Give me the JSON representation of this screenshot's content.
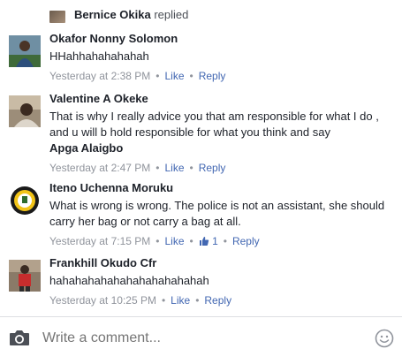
{
  "top": {
    "name": "Bernice Okika",
    "action": "replied"
  },
  "comments": [
    {
      "author": "Okafor Nonny Solomon",
      "text": "HHahhahahahahah",
      "time": "Yesterday at 2:38 PM",
      "like": "Like",
      "reply": "Reply"
    },
    {
      "author": "Valentine A Okeke",
      "text": "That is why I really advice you that am responsible for what I do , and u will b hold responsible for what you think and say",
      "mention": "Apga Alaigbo",
      "time": "Yesterday at 2:47 PM",
      "like": "Like",
      "reply": "Reply"
    },
    {
      "author": "Iteno Uchenna Moruku",
      "text": "What is wrong is wrong. The police is not an assistant, she should carry her bag or not carry a bag at all.",
      "time": "Yesterday at 7:15 PM",
      "like": "Like",
      "like_count": "1",
      "reply": "Reply"
    },
    {
      "author": "Frankhill Okudo Cfr",
      "text": "hahahahahahahahahahahahah",
      "time": "Yesterday at 10:25 PM",
      "like": "Like",
      "reply": "Reply"
    }
  ],
  "composer": {
    "placeholder": "Write a comment..."
  },
  "icons": {
    "camera": "camera-icon",
    "emoji": "smiley-icon",
    "like": "thumbs-up-icon"
  },
  "colors": {
    "link": "#4267b2",
    "meta": "#90949c",
    "text": "#1d2129"
  }
}
